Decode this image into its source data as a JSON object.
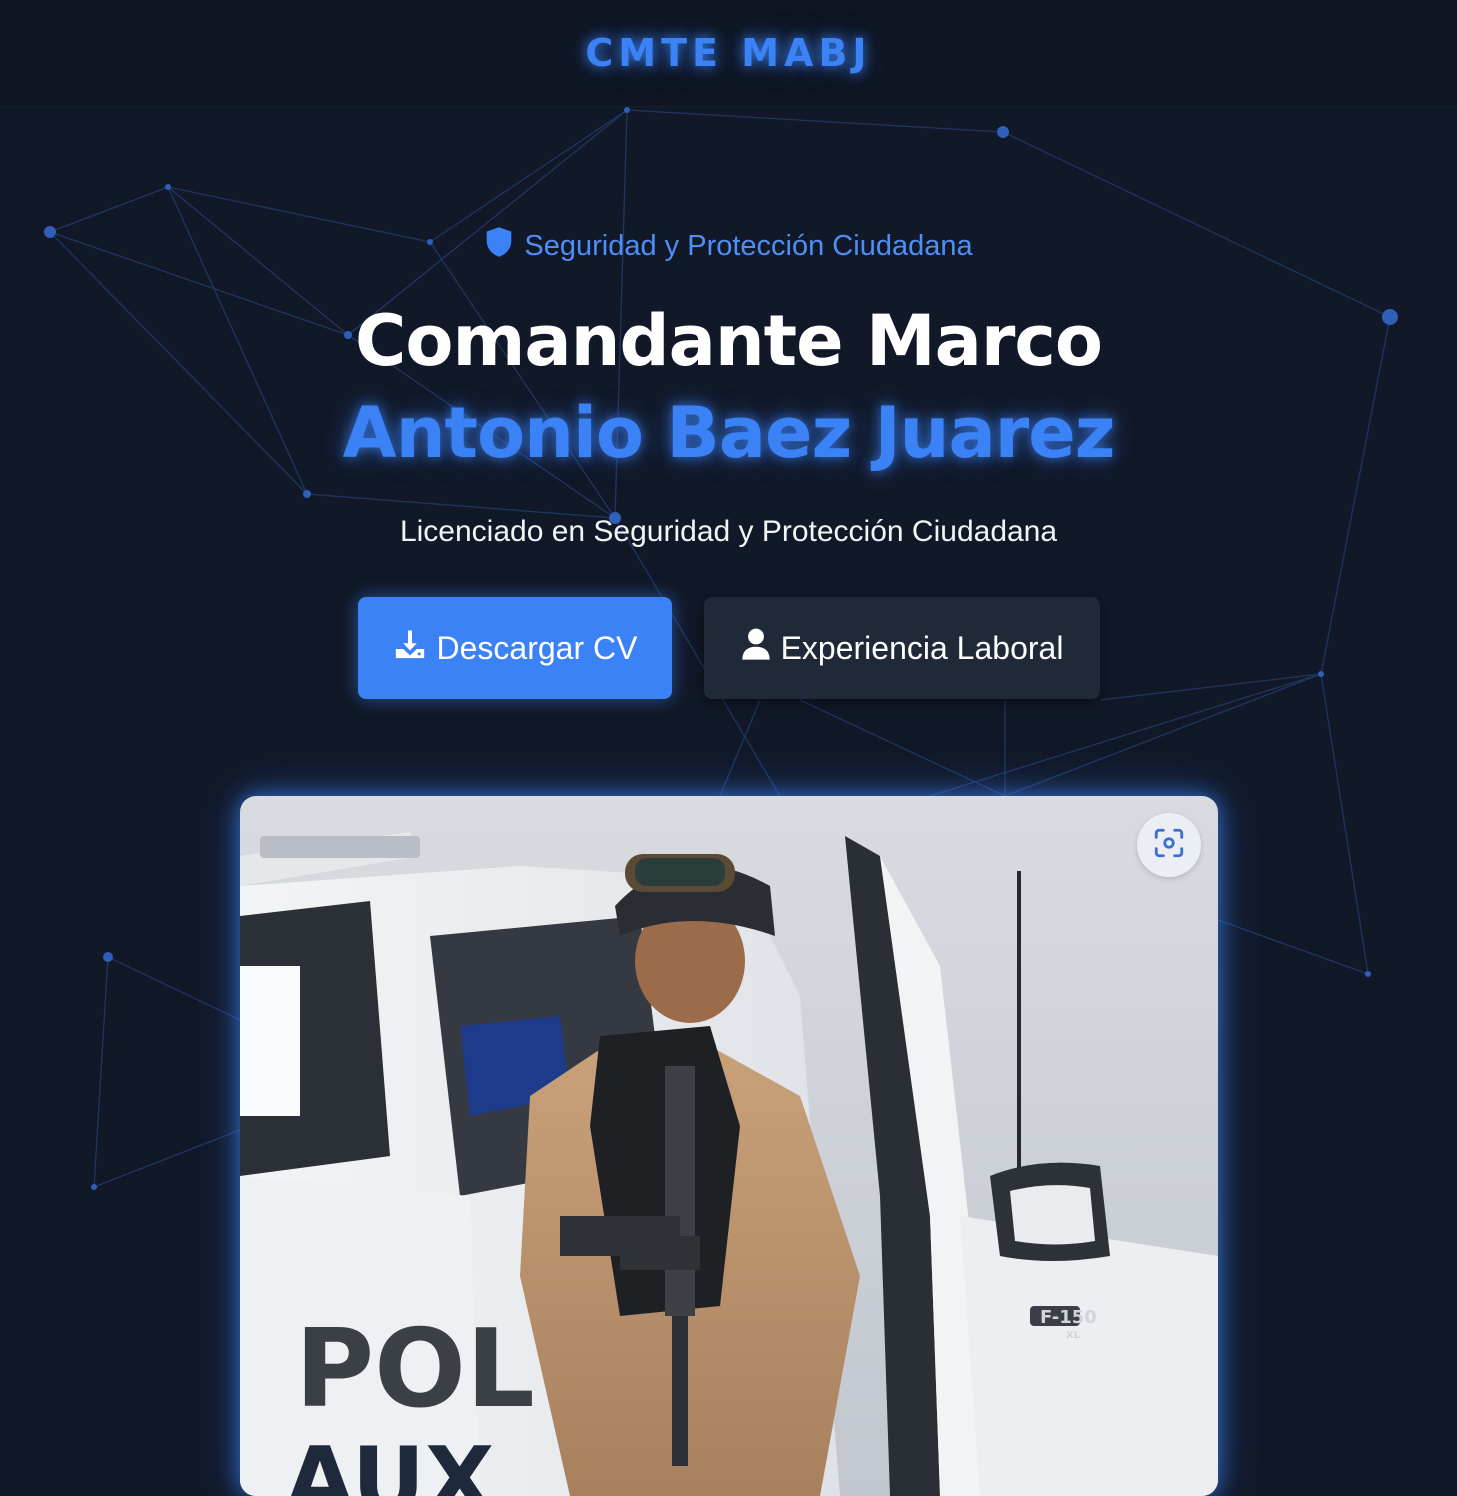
{
  "header": {
    "brand": "CMTE MABJ"
  },
  "hero": {
    "tagline": "Seguridad y Protección Ciudadana",
    "name_line1": "Comandante Marco",
    "name_line2": "Antonio Baez Juarez",
    "subtitle": "Licenciado en Seguridad y Protección Ciudadana",
    "buttons": {
      "download_cv": "Descargar CV",
      "experience": "Experiencia Laboral"
    }
  },
  "photo": {
    "vehicle_text": "POL",
    "vehicle_text_partial": "AUX",
    "badge": "F-150",
    "badge_sub": "XL"
  },
  "icons": {
    "tagline": "shield-icon",
    "download_cv": "download-icon",
    "experience": "user-icon",
    "photo_action": "lens-search-icon"
  },
  "colors": {
    "background": "#111827",
    "accent": "#3b82f6",
    "secondary_button": "#1f2937"
  }
}
